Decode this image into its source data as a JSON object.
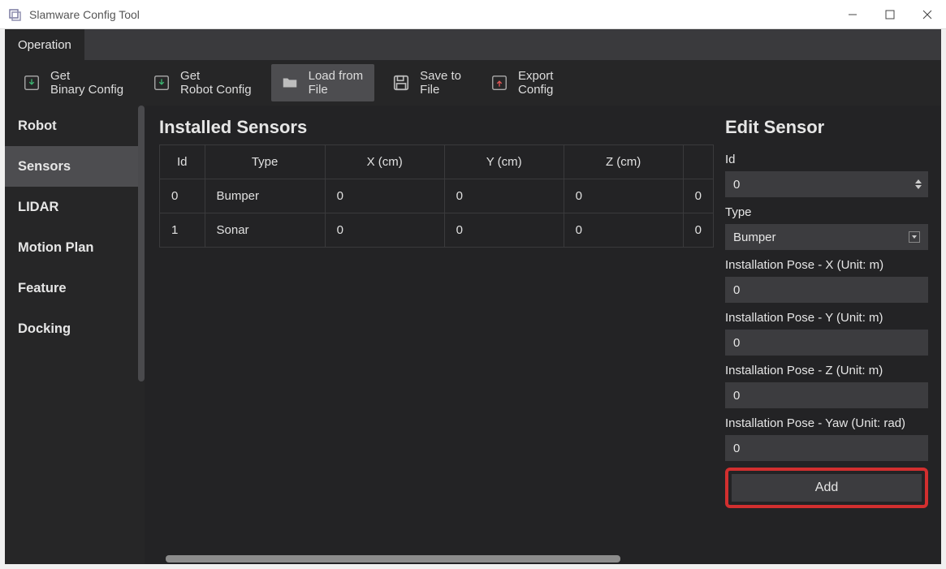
{
  "window": {
    "title": "Slamware Config Tool"
  },
  "tabs": {
    "items": [
      {
        "label": "Operation"
      }
    ],
    "active_index": 0
  },
  "toolbar": {
    "get_binary": {
      "line1": "Get",
      "line2": "Binary Config"
    },
    "get_robot": {
      "line1": "Get",
      "line2": "Robot Config"
    },
    "load_file": {
      "line1": "Load from",
      "line2": "File"
    },
    "save_file": {
      "line1": "Save to",
      "line2": "File"
    },
    "export": {
      "line1": "Export",
      "line2": "Config"
    },
    "selected": "load_file"
  },
  "sidebar": {
    "items": [
      "Robot",
      "Sensors",
      "LIDAR",
      "Motion Plan",
      "Feature",
      "Docking"
    ],
    "selected_index": 1
  },
  "sensors": {
    "title": "Installed Sensors",
    "columns": [
      "Id",
      "Type",
      "X (cm)",
      "Y (cm)",
      "Z (cm)"
    ],
    "rows": [
      {
        "id": "0",
        "type": "Bumper",
        "x": "0",
        "y": "0",
        "z": "0",
        "extra": "0"
      },
      {
        "id": "1",
        "type": "Sonar",
        "x": "0",
        "y": "0",
        "z": "0",
        "extra": "0"
      }
    ]
  },
  "edit": {
    "title": "Edit Sensor",
    "labels": {
      "id": "Id",
      "type": "Type",
      "pose_x": "Installation Pose - X (Unit: m)",
      "pose_y": "Installation Pose - Y (Unit: m)",
      "pose_z": "Installation Pose - Z (Unit: m)",
      "pose_yaw": "Installation Pose - Yaw (Unit: rad)"
    },
    "values": {
      "id": "0",
      "type": "Bumper",
      "pose_x": "0",
      "pose_y": "0",
      "pose_z": "0",
      "pose_yaw": "0"
    },
    "add_label": "Add"
  }
}
